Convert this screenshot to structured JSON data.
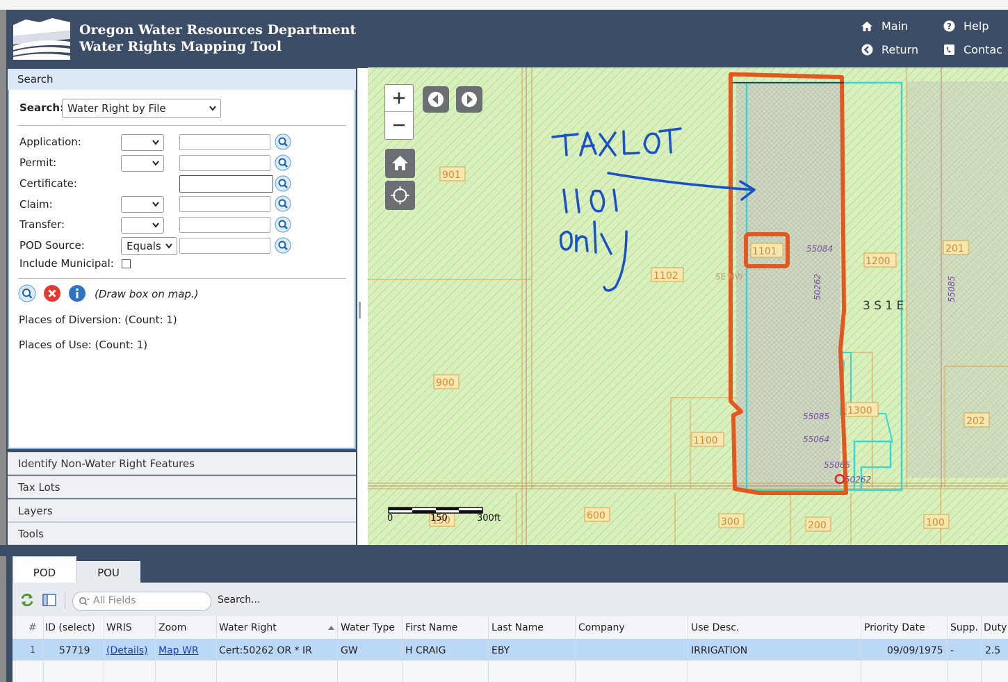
{
  "header": {
    "title_line1": "Oregon Water Resources Department",
    "title_line2": "Water Rights Mapping Tool",
    "nav": [
      {
        "label": "Main",
        "icon": "home-icon"
      },
      {
        "label": "Help",
        "icon": "question-circle-icon"
      },
      {
        "label": "Return",
        "icon": "back-circle-icon"
      },
      {
        "label": "Contac",
        "icon": "phone-icon"
      }
    ]
  },
  "search_panel": {
    "header": "Search",
    "search_label": "Search:",
    "search_type": "Water Right by File",
    "fields": [
      {
        "label": "Application:",
        "has_dropdown": true,
        "dropdown_value": ""
      },
      {
        "label": "Permit:",
        "has_dropdown": true,
        "dropdown_value": ""
      },
      {
        "label": "Certificate:",
        "has_dropdown": false,
        "dropdown_value": ""
      },
      {
        "label": "Claim:",
        "has_dropdown": true,
        "dropdown_value": ""
      },
      {
        "label": "Transfer:",
        "has_dropdown": true,
        "dropdown_value": ""
      },
      {
        "label": "POD Source:",
        "has_dropdown": true,
        "dropdown_value": "Equals"
      }
    ],
    "include_municipal": "Include Municipal:",
    "draw_hint": "(Draw box on map.)",
    "pod_count": "Places of Diversion: (Count: 1)",
    "pou_count": "Places of Use: (Count: 1)"
  },
  "accordion": [
    "Identify Non-Water Right Features",
    "Tax Lots",
    "Layers",
    "Tools"
  ],
  "map": {
    "annotation_text": [
      "TAX LOT",
      "1101",
      "only"
    ],
    "township": "3 S 1 E",
    "lot_labels": [
      "901",
      "1102",
      "1101",
      "1200",
      "201",
      "900",
      "1100",
      "1300",
      "202",
      "600",
      "300",
      "200",
      "100",
      "150"
    ],
    "feature_numbers": [
      "55084",
      "50262",
      "55085",
      "55064",
      "55065",
      "50262",
      "55085"
    ],
    "partial_label": "SE NW",
    "scale": {
      "zero": "0",
      "mid": "150",
      "end": "300ft"
    }
  },
  "results": {
    "tabs": [
      "POD",
      "POU"
    ],
    "active_tab": "POD",
    "search_placeholder": "All Fields",
    "search_label": "Search...",
    "columns": [
      "#",
      "ID (select)",
      "WRIS",
      "Zoom",
      "Water Right",
      "Water Type",
      "First Name",
      "Last Name",
      "Company",
      "Use Desc.",
      "Priority Date",
      "Supp.",
      "Duty"
    ],
    "rows": [
      [
        "1",
        "57719",
        "(Details)",
        "Map WR",
        "Cert:50262 OR * IR",
        "GW",
        "H CRAIG",
        "EBY",
        "",
        "IRRIGATION",
        "09/09/1975",
        "-",
        "2.5"
      ]
    ]
  }
}
